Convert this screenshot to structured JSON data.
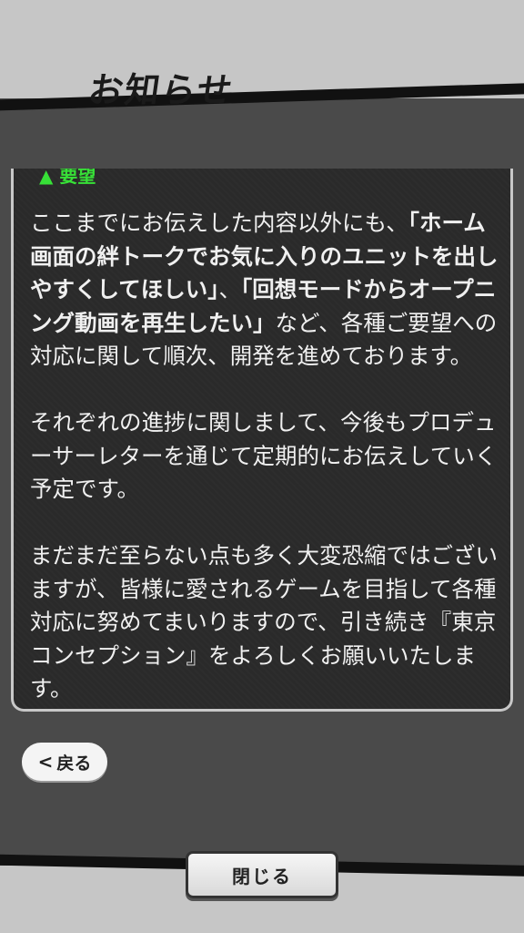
{
  "header": {
    "title": "お知らせ"
  },
  "content": {
    "scroll_hint": "▲ 要望",
    "para1_a": "ここまでにお伝えした内容以外にも、",
    "para1_b": "「ホーム画面の絆トークでお気に入りのユニットを出しやすくしてほしい」",
    "para1_c": "、",
    "para1_d": "「回想モードからオープニング動画を再生したい」",
    "para1_e": "など、各種ご要望への対応に関して順次、開発を進めております。",
    "para2": "それぞれの進捗に関しまして、今後もプロデューサーレターを通じて定期的にお伝えしていく予定です。",
    "para3": "まだまだ至らない点も多く大変恐縮ではございますが、皆様に愛されるゲームを目指して各種対応に努めてまいりますので、引き続き『東京コンセプション』をよろしくお願いいたします。"
  },
  "buttons": {
    "back_label": "戻る",
    "close_label": "閉じる"
  },
  "colors": {
    "panel_bg": "#4a4a4a",
    "content_bg": "#2a2a2a",
    "header_bg": "#c6c6c6",
    "hint_green": "#37e037"
  }
}
